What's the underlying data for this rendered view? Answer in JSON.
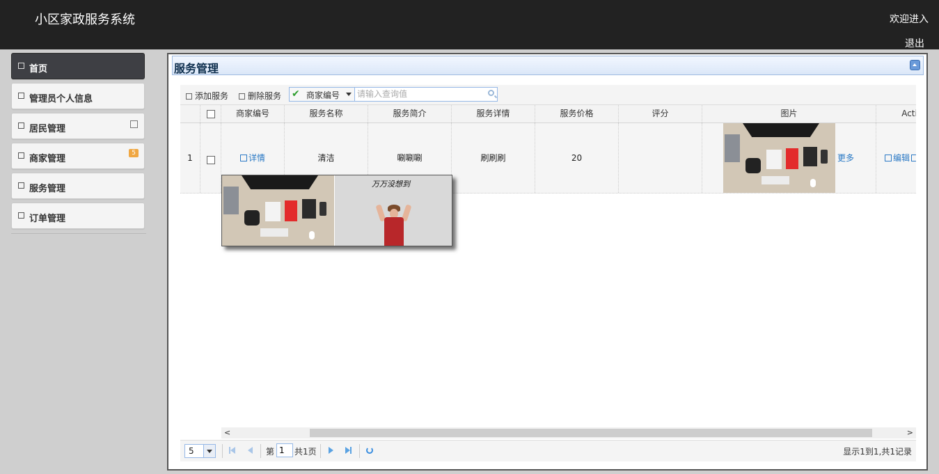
{
  "app": {
    "title": "小区家政服务系统",
    "welcome": "欢迎进入",
    "logout": "退出"
  },
  "sidebar": {
    "items": [
      {
        "label": "首页",
        "active": true
      },
      {
        "label": "管理员个人信息"
      },
      {
        "label": "居民管理"
      },
      {
        "label": "商家管理",
        "badge": "5"
      },
      {
        "label": "服务管理"
      },
      {
        "label": "订单管理"
      }
    ]
  },
  "panel": {
    "title": "服务管理"
  },
  "toolbar": {
    "add_label": "添加服务",
    "delete_label": "删除服务",
    "search_field": "商家编号",
    "search_placeholder": "请输入查询值"
  },
  "table": {
    "columns": [
      "商家编号",
      "服务名称",
      "服务简介",
      "服务详情",
      "服务价格",
      "评分",
      "图片",
      "Action"
    ],
    "rows": [
      {
        "row_number": "1",
        "merchant_link": "详情",
        "service_name": "清洁",
        "service_intro": "唰唰唰",
        "service_detail": "刷刷刷",
        "price": "20",
        "rating": "",
        "more_link": "更多",
        "action_edit": "编辑"
      }
    ]
  },
  "tooltip": {
    "caption": "万万没想到"
  },
  "pager": {
    "page_size": "5",
    "page_prefix": "第",
    "page_value": "1",
    "page_total": "共1页",
    "info": "显示1到1,共1记录"
  },
  "colors": {
    "topbar": "#222222",
    "active_nav": "#3e3f44",
    "link": "#2a79c5",
    "badge": "#f0a742",
    "panel_border": "#95b8e7"
  }
}
